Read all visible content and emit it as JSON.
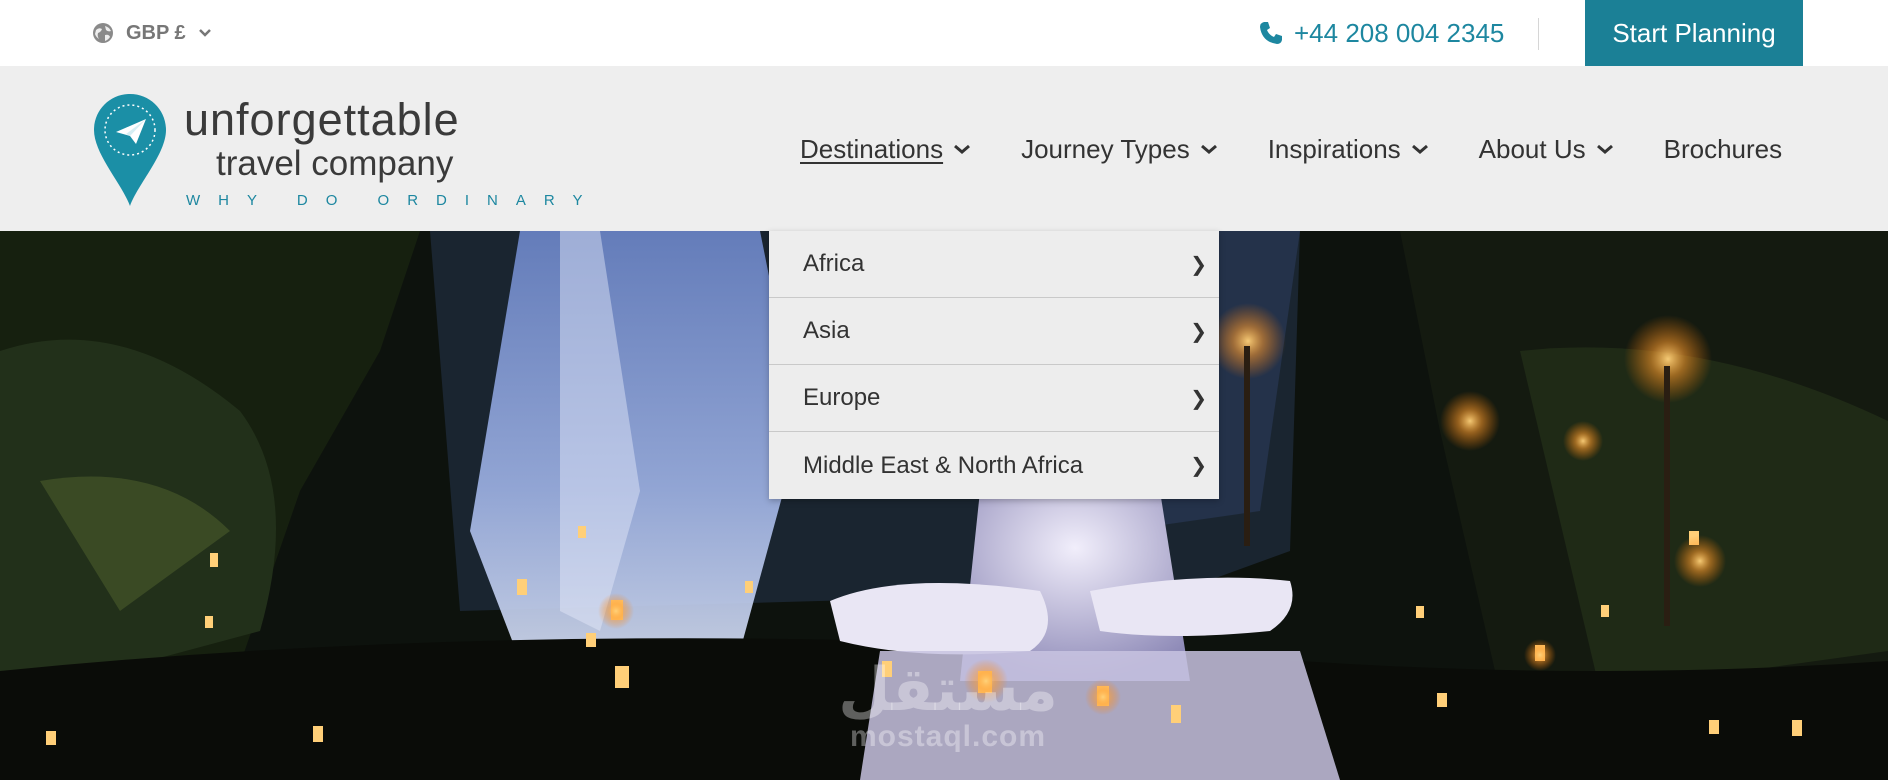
{
  "topbar": {
    "currency_label": "GBP £",
    "phone": "+44 208 004 2345",
    "cta_label": "Start Planning"
  },
  "logo": {
    "line1": "unforgettable",
    "line2": "travel company",
    "tagline": "WHY DO ORDINARY"
  },
  "nav": {
    "items": [
      {
        "label": "Destinations",
        "has_dropdown": true,
        "active": true
      },
      {
        "label": "Journey Types",
        "has_dropdown": true
      },
      {
        "label": "Inspirations",
        "has_dropdown": true
      },
      {
        "label": "About Us",
        "has_dropdown": true
      },
      {
        "label": "Brochures",
        "has_dropdown": false
      }
    ]
  },
  "dropdown": {
    "items": [
      {
        "label": "Africa"
      },
      {
        "label": "Asia"
      },
      {
        "label": "Europe"
      },
      {
        "label": "Middle East & North Africa"
      }
    ],
    "arrow": "❯"
  },
  "watermark": {
    "arabic": "مستقل",
    "latin": "mostaql.com"
  },
  "colors": {
    "brand_teal": "#1b8096",
    "link_teal": "#1d87a0",
    "header_bg": "#eeeeee",
    "dropdown_bg": "#ededed"
  },
  "icons": {
    "globe": "globe-icon",
    "phone": "phone-icon",
    "logo_pin": "paper-plane-pin-icon",
    "chevron": "chevron-down-icon",
    "arrow": "chevron-right-icon"
  }
}
